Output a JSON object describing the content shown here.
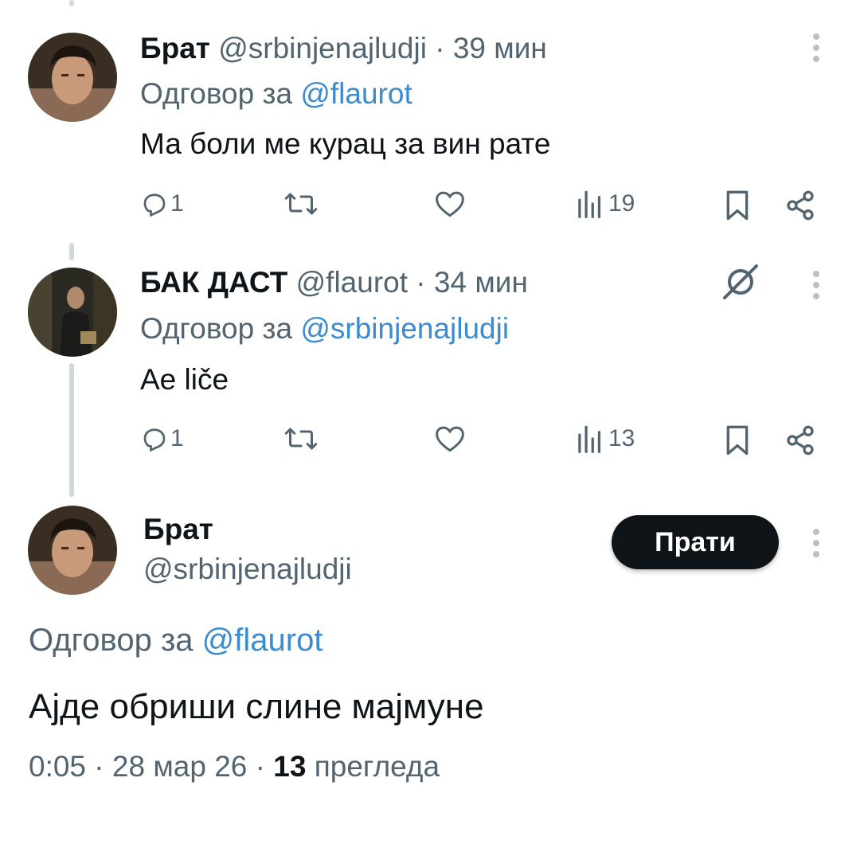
{
  "colors": {
    "text": "#0f1419",
    "muted": "#536471",
    "link": "#1d9bf0",
    "line": "#cfd9de"
  },
  "tweets": [
    {
      "name": "Брат",
      "handle": "@srbinjenajludji",
      "sep": "·",
      "time": "39 мин",
      "reply_prefix": "Одговор за",
      "reply_to": "@flaurot",
      "text": "Ма боли ме курац за вин рате",
      "replies": "1",
      "views": "19",
      "icons": [
        "reply-icon",
        "retweet-icon",
        "like-icon",
        "views-icon",
        "bookmark-icon",
        "share-icon",
        "more-icon"
      ]
    },
    {
      "name": "БАК ДАСТ",
      "handle": "@flaurot",
      "sep": "·",
      "time": "34 мин",
      "reply_prefix": "Одговор за",
      "reply_to": "@srbinjenajludji",
      "text": "Ae liče",
      "replies": "1",
      "views": "13",
      "icons": [
        "reply-icon",
        "retweet-icon",
        "like-icon",
        "views-icon",
        "bookmark-icon",
        "share-icon",
        "grok-icon",
        "more-icon"
      ]
    }
  ],
  "main": {
    "name": "Брат",
    "handle": "@srbinjenajludji",
    "follow_label": "Прати",
    "reply_prefix": "Одговор за",
    "reply_to": "@flaurot",
    "text": "Ајде обриши слине мајмуне",
    "time": "0:05",
    "date": "28 мар 26",
    "sep": "·",
    "views": "13",
    "views_label": "прегледа"
  }
}
